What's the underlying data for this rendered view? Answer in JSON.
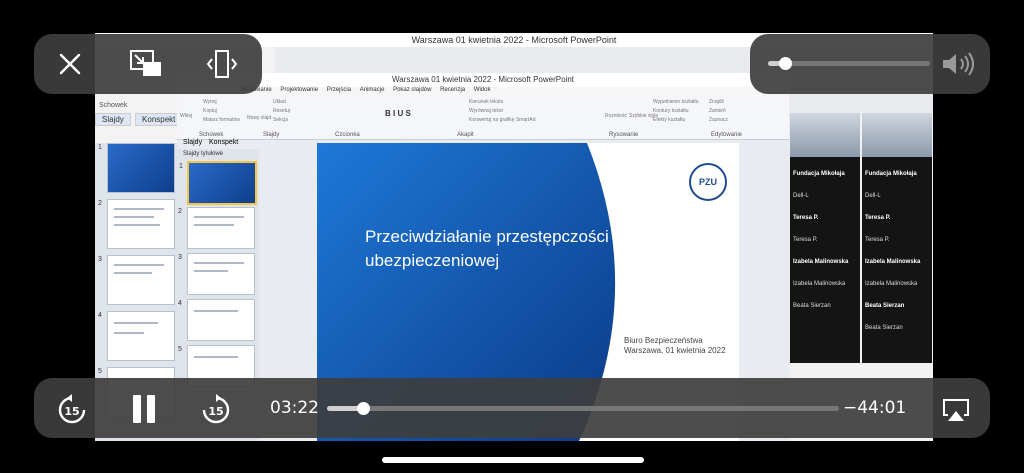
{
  "presentation": {
    "outer_window_title": "Warszawa 01 kwietnia 2022 - Microsoft PowerPoint",
    "inner_window_title": "Warszawa 01 kwietnia 2022 - Microsoft PowerPoint",
    "outer_panel_tabs": [
      "Slajdy",
      "Konspekt"
    ],
    "outer_schowek": "Schowek",
    "inner_panel_tabs": [
      "Slajdy",
      "Konspekt"
    ],
    "inner_slides_header": "Slajdy tytułowe",
    "menu": [
      "Wstawianie",
      "Projektowanie",
      "Przejścia",
      "Animacje",
      "Pokaz slajdów",
      "Recenzja",
      "Widok"
    ],
    "ribbon_groups": [
      "Schowek",
      "Slajdy",
      "Czcionka",
      "Akapit",
      "Rysowanie",
      "Edytowanie"
    ],
    "ribbon_buttons": {
      "paste": "Wklej",
      "cut": "Wytnij",
      "copy": "Kopiuj",
      "format": "Malarz formatów",
      "new_slide": "Nowy slajd",
      "layout": "Układ",
      "reset": "Resetuj",
      "section": "Sekcja",
      "text_dir": "Kierunek tekstu",
      "align_text": "Wyrównaj tekst",
      "smartart": "Konwertuj na grafikę SmartArt",
      "arrange": "Rozmieść",
      "quick_styles": "Szybkie style",
      "fill": "Wypełnienie kształtu",
      "outline": "Kontury kształtu",
      "effects": "Efekty kształtu",
      "find": "Znajdź",
      "replace": "Zamień",
      "select": "Zaznacz"
    },
    "slide_numbers": [
      "1",
      "2",
      "3",
      "4",
      "5"
    ],
    "slide": {
      "title_line1": "Przeciwdziałanie przestępczości",
      "title_line2": "ubezpieczeniowej",
      "dept": "Biuro Bezpieczeństwa",
      "date": "Warszawa, 01 kwietnia 2022",
      "logo": "PZU"
    },
    "participants_left": [
      {
        "label": "Fundacja Mikołaja",
        "bold": true
      },
      {
        "label": "Dell-L",
        "bold": false
      },
      {
        "label": "Teresa P.",
        "bold": true
      },
      {
        "label": "Teresa P.",
        "bold": false
      },
      {
        "label": "Izabela Malinowska",
        "bold": true
      },
      {
        "label": "Izabela Malinowska",
        "bold": false
      },
      {
        "label": "Beata Sierzan",
        "bold": false
      }
    ],
    "participants_right": [
      {
        "label": "Fundacja Mikołaja",
        "bold": true
      },
      {
        "label": "Dell-L",
        "bold": false
      },
      {
        "label": "Teresa P.",
        "bold": true
      },
      {
        "label": "Teresa P.",
        "bold": false
      },
      {
        "label": "Izabela Malinowska",
        "bold": true
      },
      {
        "label": "Izabela Malinowska",
        "bold": false
      },
      {
        "label": "Beata Sierzan",
        "bold": true
      },
      {
        "label": "Beata Sierzan",
        "bold": false
      }
    ]
  },
  "player": {
    "elapsed": "03:22",
    "remaining": "−44:01",
    "skip_back_seconds": "15",
    "skip_forward_seconds": "15",
    "progress": 0.071,
    "volume": 0.08,
    "icons": {
      "close": "close-icon",
      "pip": "picture-in-picture-icon",
      "fit": "aspect-fit-icon",
      "pause": "pause-icon",
      "skip_back": "skip-back-15-icon",
      "skip_forward": "skip-forward-15-icon",
      "airplay": "airplay-icon",
      "volume": "speaker-icon"
    }
  }
}
